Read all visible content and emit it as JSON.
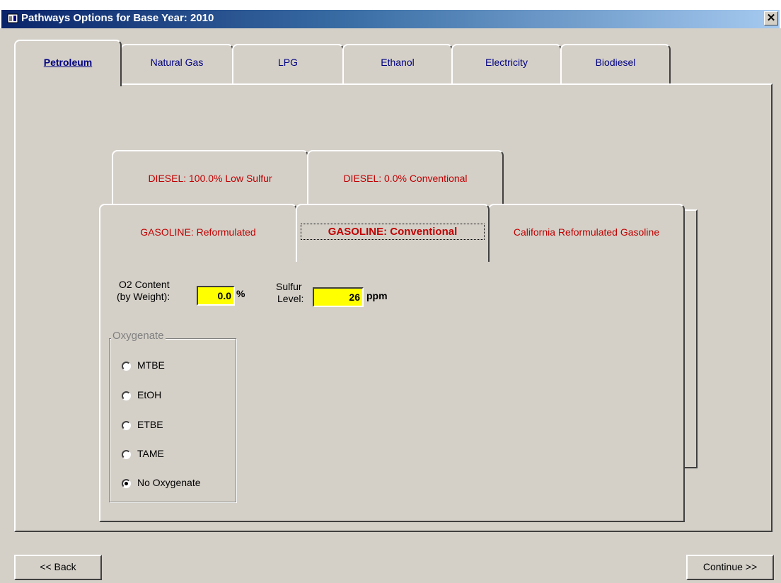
{
  "window": {
    "title": "Pathways Options for Base Year: 2010",
    "close_label": "✕"
  },
  "main_tabs": [
    {
      "label": "Petroleum",
      "active": true
    },
    {
      "label": "Natural Gas",
      "active": false
    },
    {
      "label": "LPG",
      "active": false
    },
    {
      "label": "Ethanol",
      "active": false
    },
    {
      "label": "Electricity",
      "active": false
    },
    {
      "label": "Biodiesel",
      "active": false
    }
  ],
  "fuel_tabs_row1": [
    {
      "label": "DIESEL: 100.0% Low Sulfur"
    },
    {
      "label": "DIESEL: 0.0% Conventional"
    }
  ],
  "fuel_tabs_row2": [
    {
      "label": "GASOLINE: Reformulated",
      "active": false
    },
    {
      "label": "GASOLINE: Conventional",
      "active": true
    },
    {
      "label": "California Reformulated Gasoline",
      "active": false
    }
  ],
  "o2": {
    "label_line1": "O2 Content",
    "label_line2": "(by Weight):",
    "value": "0.0",
    "unit": "%"
  },
  "sulfur": {
    "label_line1": "Sulfur",
    "label_line2": "Level:",
    "value": "26",
    "unit": "ppm"
  },
  "oxygenate": {
    "group_label": "Oxygenate",
    "options": [
      {
        "label": "MTBE",
        "selected": false
      },
      {
        "label": "EtOH",
        "selected": false
      },
      {
        "label": "ETBE",
        "selected": false
      },
      {
        "label": "TAME",
        "selected": false
      },
      {
        "label": "No Oxygenate",
        "selected": true
      }
    ]
  },
  "buttons": {
    "back": "<< Back",
    "continue": "Continue >>"
  },
  "colors": {
    "face": "#d4d0c8",
    "title_bar_start": "#0a246a",
    "title_bar_end": "#a6caf0",
    "fuel_tab_text": "#c00000",
    "input_bg": "#ffff00",
    "tab_text": "#000080"
  }
}
